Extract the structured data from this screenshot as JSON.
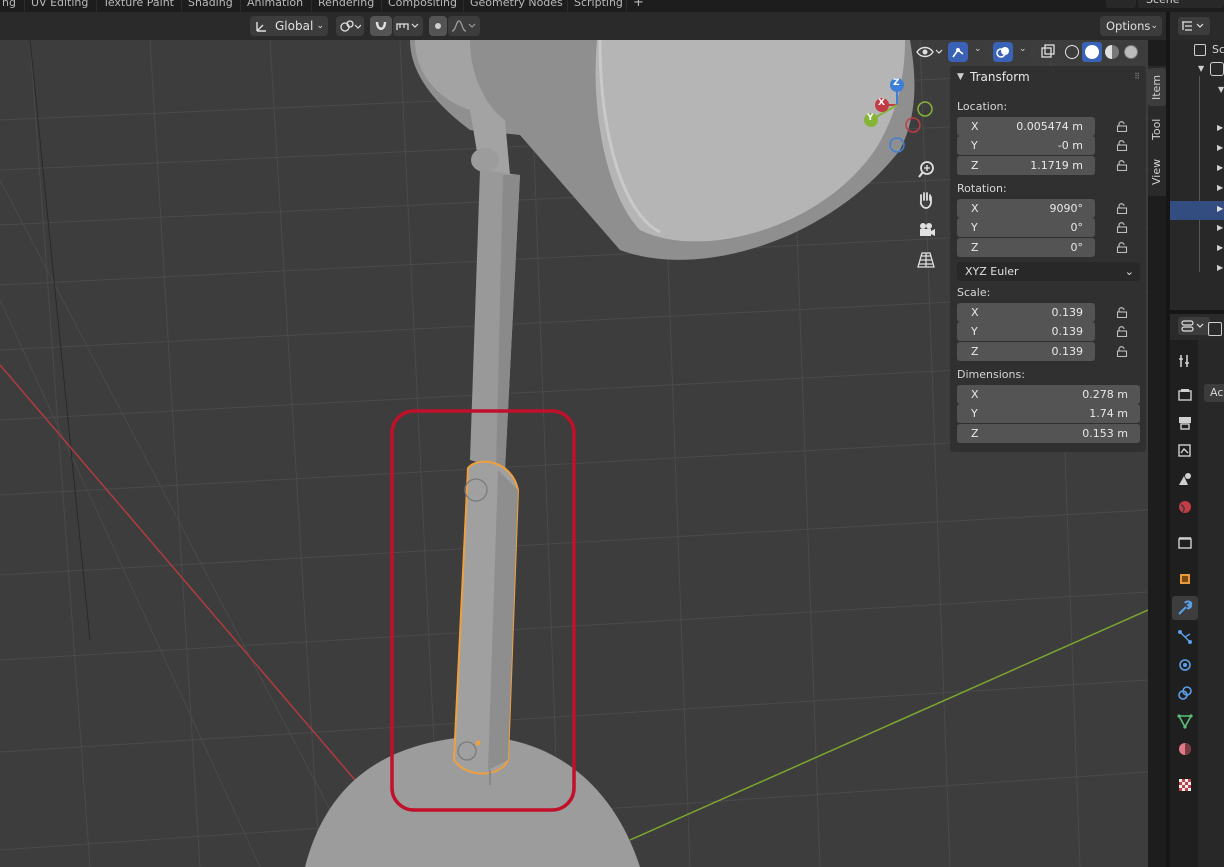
{
  "workspace_tabs": [
    "ng",
    "UV Editing",
    "Texture Paint",
    "Shading",
    "Animation",
    "Rendering",
    "Compositing",
    "Geometry Nodes",
    "Scripting"
  ],
  "add_tab": "+",
  "scene_name": "Scene",
  "header": {
    "orientation": "Global",
    "options": "Options"
  },
  "npanel": {
    "title": "Transform",
    "location_label": "Location:",
    "location": [
      {
        "axis": "X",
        "value": "0.005474 m"
      },
      {
        "axis": "Y",
        "value": "-0 m"
      },
      {
        "axis": "Z",
        "value": "1.1719 m"
      }
    ],
    "rotation_label": "Rotation:",
    "rotation": [
      {
        "axis": "X",
        "value": "9090°"
      },
      {
        "axis": "Y",
        "value": "0°"
      },
      {
        "axis": "Z",
        "value": "0°"
      }
    ],
    "rotation_mode": "XYZ Euler",
    "scale_label": "Scale:",
    "scale": [
      {
        "axis": "X",
        "value": "0.139"
      },
      {
        "axis": "Y",
        "value": "0.139"
      },
      {
        "axis": "Z",
        "value": "0.139"
      }
    ],
    "dimensions_label": "Dimensions:",
    "dimensions": [
      {
        "axis": "X",
        "value": "0.278 m"
      },
      {
        "axis": "Y",
        "value": "1.74 m"
      },
      {
        "axis": "Z",
        "value": "0.153 m"
      }
    ]
  },
  "side_tabs": [
    "Item",
    "Tool",
    "View"
  ],
  "gizmo": {
    "x": "X",
    "y": "Y",
    "z": "Z"
  },
  "outliner_label": "Sc",
  "props_label": "Ac",
  "colors": {
    "viewport": "#3d3d3d",
    "selection": "#f0a040",
    "highlight_box": "#c0102a",
    "x_axis": "#c23c46",
    "y_axis": "#86b438",
    "z_axis": "#3d7fd6",
    "active_blue": "#3a63b8"
  }
}
